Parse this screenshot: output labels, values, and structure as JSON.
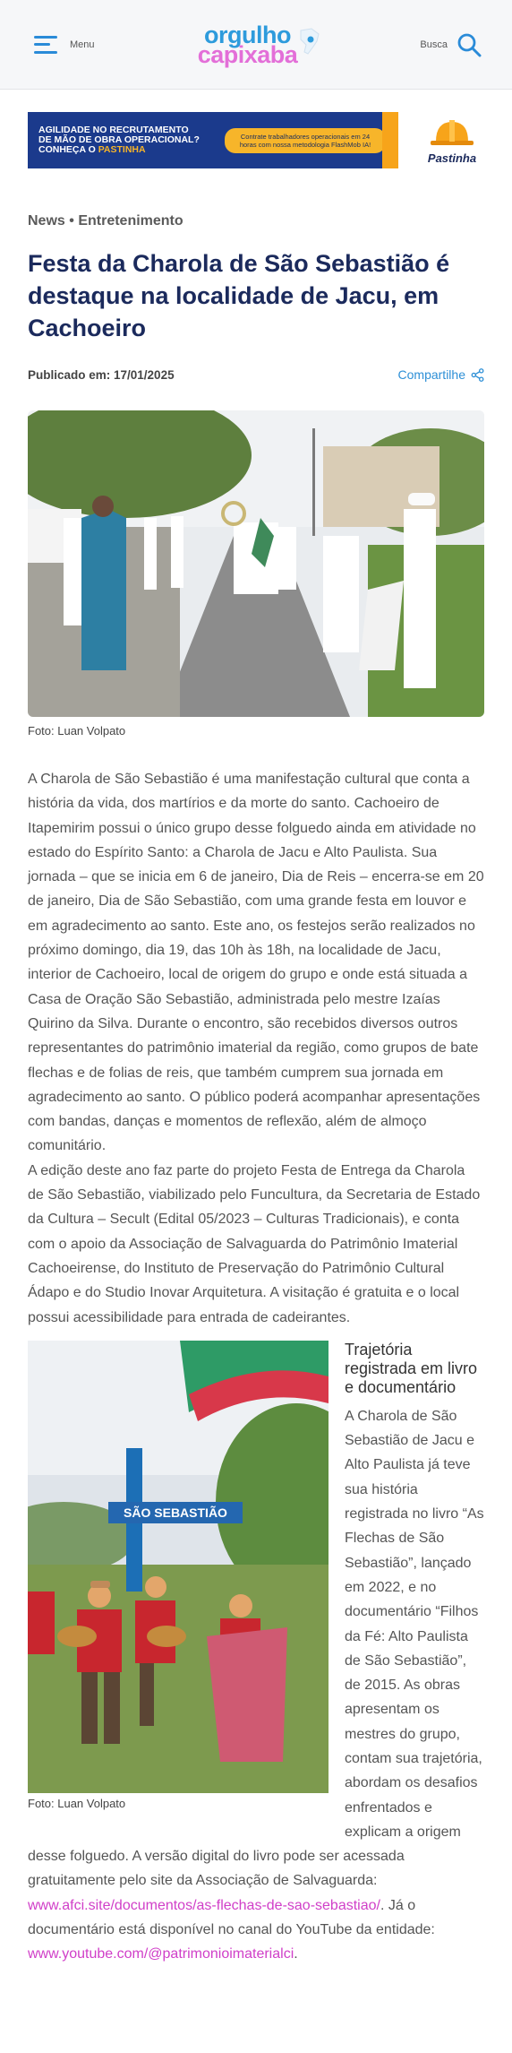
{
  "header": {
    "menu_label": "Menu",
    "logo_line1": "orgulho",
    "logo_line2": "capixaba",
    "search_label": "Busca"
  },
  "ad": {
    "headline_1": "AGILIDADE NO RECRUTAMENTO",
    "headline_2": "DE MÃO DE OBRA OPERACIONAL?",
    "headline_3": "CONHEÇA O",
    "headline_brand": "PASTINHA",
    "pill_text": "Contrate trabalhadores operacionais em 24 horas com nossa metodologia FlashMob IA!",
    "brand_name": "Pastinha",
    "colors": {
      "navy": "#1b3a8c",
      "orange": "#f7b52a"
    }
  },
  "article": {
    "category_1": "News",
    "separator": "•",
    "category_2": "Entretenimento",
    "title": "Festa da Charola de São Sebastião é destaque na localidade de Jacu, em Cachoeiro",
    "published": "Publicado em: 17/01/2025",
    "share_label": "Compartilhe",
    "photo1_caption": "Foto: Luan Volpato",
    "paragraph_1": "A Charola de São Sebastião é uma manifestação cultural que conta a história da vida, dos martírios e da morte do santo. Cachoeiro de Itapemirim possui o único grupo desse folguedo ainda em atividade no estado do Espírito Santo: a Charola de Jacu e Alto Paulista. Sua jornada – que se inicia em 6 de janeiro, Dia de Reis – encerra-se em 20 de janeiro, Dia de São Sebastião, com uma grande festa em louvor e em agradecimento ao santo. Este ano, os festejos serão realizados no próximo domingo, dia 19, das 10h às 18h, na localidade de Jacu, interior de Cachoeiro, local de origem do grupo e onde está situada a Casa de Oração São Sebastião, administrada pelo mestre Izaías Quirino da Silva. Durante o encontro, são recebidos diversos outros representantes do patrimônio imaterial da região, como grupos de bate flechas e de folias de reis, que também cumprem sua jornada em agradecimento ao santo. O público poderá acompanhar apresentações com bandas, danças e momentos de reflexão, além de almoço comunitário.",
    "paragraph_2": "A edição deste ano faz parte do projeto Festa de Entrega da Charola de São Sebastião, viabilizado pelo Funcultura, da Secretaria de Estado da Cultura – Secult (Edital 05/2023 – Culturas Tradicionais), e conta com o apoio da Associação de Salvaguarda do Patrimônio Imaterial Cachoeirense, do Instituto de Preservação do Patrimônio Cultural Ádapo e do Studio Inovar Arquitetura. A visitação é gratuita e o local possui acessibilidade para entrada de cadeirantes.",
    "photo2_sign": "SÃO SEBASTIÃO",
    "photo2_caption": "Foto: Luan Volpato",
    "subheading": "Trajetória registrada em livro e documentário",
    "paragraph_3_a": "A Charola de São Sebastião de Jacu e Alto Paulista já teve sua história registrada no livro “As Flechas de São Sebastião”, lançado em 2022, e no documentário “Filhos da Fé: Alto Paulista de São Sebastião”, de 2015. As obras apresentam os mestres do grupo, contam sua trajetória, abordam os desafios enfrentados e explicam a origem desse folguedo. A versão digital do livro pode ser acessada gratuitamente pelo site da Associação de Salvaguarda: ",
    "link_book": "www.afci.site/documentos/as-flechas-de-sao-sebastiao/",
    "paragraph_3_b": ". Já o documentário está disponível no canal do YouTube da entidade: ",
    "link_youtube": "www.youtube.com/@patrimonioimaterialci",
    "paragraph_3_c": "."
  }
}
